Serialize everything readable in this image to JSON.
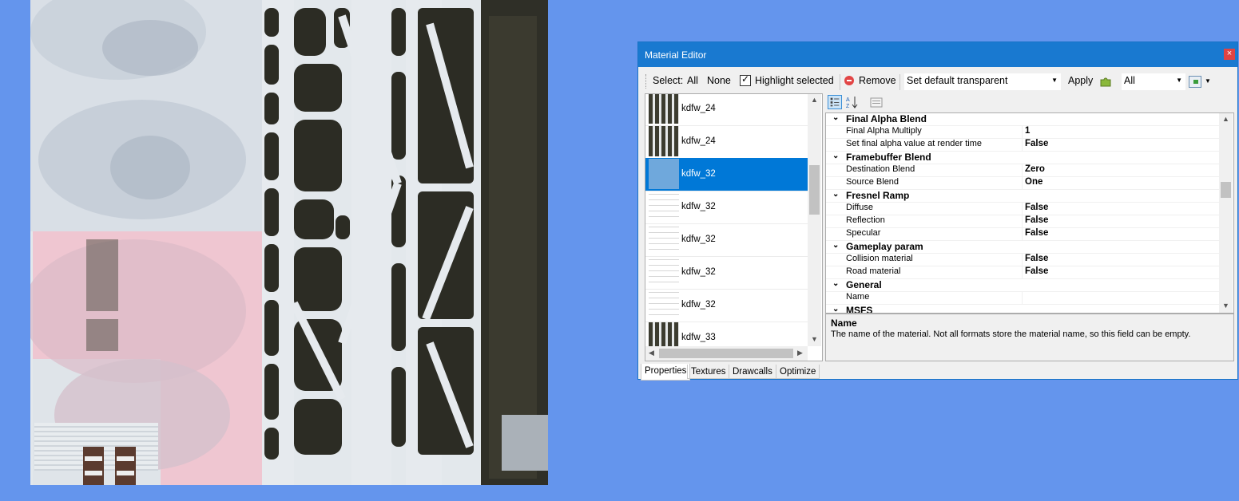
{
  "window": {
    "title": "Material Editor",
    "close_glyph": "×"
  },
  "toolbar": {
    "select_label": "Select:",
    "all_label": "All",
    "none_label": "None",
    "highlight_label": "Highlight selected",
    "highlight_checked": true,
    "remove_label": "Remove",
    "default_combo_value": "Set default transparent",
    "apply_label": "Apply",
    "filter_combo_value": "All",
    "icons": [
      "remove-icon",
      "apply-puzzle-icon",
      "export-icon"
    ]
  },
  "materials": [
    {
      "name": "kdfw_24",
      "selected": false
    },
    {
      "name": "kdfw_24",
      "selected": false
    },
    {
      "name": "kdfw_32",
      "selected": true
    },
    {
      "name": "kdfw_32",
      "selected": false
    },
    {
      "name": "kdfw_32",
      "selected": false
    },
    {
      "name": "kdfw_32",
      "selected": false
    },
    {
      "name": "kdfw_32",
      "selected": false
    },
    {
      "name": "kdfw_33",
      "selected": false
    }
  ],
  "properties": [
    {
      "type": "category",
      "name": "Final Alpha Blend"
    },
    {
      "type": "prop",
      "name": "Final Alpha Multiply",
      "value": "1"
    },
    {
      "type": "prop",
      "name": "Set final alpha value at render time",
      "value": "False"
    },
    {
      "type": "category",
      "name": "Framebuffer Blend"
    },
    {
      "type": "prop",
      "name": "Destination Blend",
      "value": "Zero"
    },
    {
      "type": "prop",
      "name": "Source Blend",
      "value": "One"
    },
    {
      "type": "category",
      "name": "Fresnel Ramp"
    },
    {
      "type": "prop",
      "name": "Diffuse",
      "value": "False"
    },
    {
      "type": "prop",
      "name": "Reflection",
      "value": "False"
    },
    {
      "type": "prop",
      "name": "Specular",
      "value": "False"
    },
    {
      "type": "category",
      "name": "Gameplay param"
    },
    {
      "type": "prop",
      "name": "Collision material",
      "value": "False"
    },
    {
      "type": "prop",
      "name": "Road material",
      "value": "False"
    },
    {
      "type": "category",
      "name": "General"
    },
    {
      "type": "prop",
      "name": "Name",
      "value": ""
    },
    {
      "type": "category",
      "name": "MSFS"
    }
  ],
  "help": {
    "title": "Name",
    "description": "The name of the material. Not all formats store the material name, so this field can be empty."
  },
  "tabs": [
    {
      "label": "Properties",
      "active": true
    },
    {
      "label": "Textures",
      "active": false
    },
    {
      "label": "Drawcalls",
      "active": false
    },
    {
      "label": "Optimize",
      "active": false
    }
  ],
  "colors": {
    "background": "#6495ED",
    "titlebar": "#1979d0",
    "selection": "#0078d7",
    "highlight_overlay": "#f4a3b8"
  }
}
